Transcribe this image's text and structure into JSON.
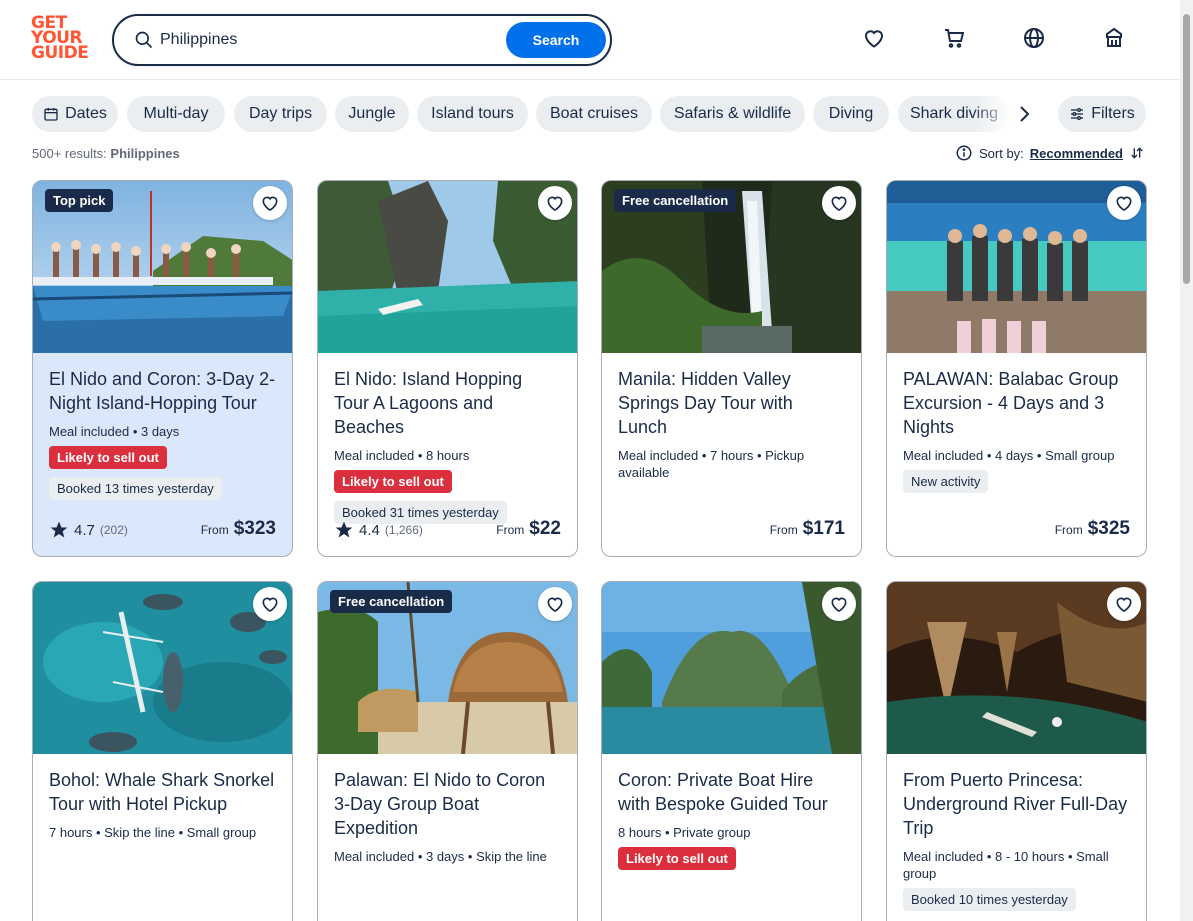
{
  "brand": {
    "logo_lines": [
      "GET",
      "YOUR",
      "GUIDE"
    ],
    "logo_color": "#ff5533"
  },
  "search": {
    "value": "Philippines",
    "button_label": "Search",
    "button_color": "#0071eb"
  },
  "header_icons": [
    "heart-icon",
    "cart-icon",
    "globe-icon",
    "account-icon"
  ],
  "chips": [
    {
      "label": "Dates",
      "icon": "calendar-icon"
    },
    {
      "label": "Multi-day"
    },
    {
      "label": "Day trips"
    },
    {
      "label": "Jungle"
    },
    {
      "label": "Island tours"
    },
    {
      "label": "Boat cruises"
    },
    {
      "label": "Safaris & wildlife"
    },
    {
      "label": "Diving"
    },
    {
      "label": "Shark diving"
    }
  ],
  "filters_label": "Filters",
  "results": {
    "count": "500+ results:",
    "query": "Philippines"
  },
  "sort": {
    "label": "Sort by:",
    "value": "Recommended"
  },
  "cards": [
    {
      "badge": "Top pick",
      "title": "El Nido and Coron: 3-Day 2-Night Island-Hopping Tour",
      "meta": "Meal included • 3 days",
      "red_tag": "Likely to sell out",
      "grey_tag": "Booked 13 times yesterday",
      "rating": "4.7",
      "rating_count": "(202)",
      "from": "From",
      "price": "$323",
      "highlighted": true
    },
    {
      "badge": "",
      "title": "El Nido: Island Hopping Tour A Lagoons and Beaches",
      "meta": "Meal included • 8 hours",
      "red_tag": "Likely to sell out",
      "grey_tag": "Booked 31 times yesterday",
      "rating": "4.4",
      "rating_count": "(1,266)",
      "from": "From",
      "price": "$22"
    },
    {
      "badge": "Free cancellation",
      "title": "Manila: Hidden Valley Springs Day Tour with Lunch",
      "meta": "Meal included • 7 hours • Pickup available",
      "from": "From",
      "price": "$171"
    },
    {
      "badge": "",
      "title": "PALAWAN: Balabac Group Excursion - 4 Days and 3 Nights",
      "meta": "Meal included • 4 days • Small group",
      "grey_tag": "New activity",
      "from": "From",
      "price": "$325"
    },
    {
      "badge": "",
      "title": "Bohol: Whale Shark Snorkel Tour with Hotel Pickup",
      "meta": "7 hours • Skip the line • Small group"
    },
    {
      "badge": "Free cancellation",
      "title": "Palawan: El Nido to Coron 3-Day Group Boat Expedition",
      "meta": "Meal included • 3 days • Skip the line"
    },
    {
      "badge": "",
      "title": "Coron: Private Boat Hire with Bespoke Guided Tour",
      "meta": "8 hours • Private group",
      "red_tag": "Likely to sell out"
    },
    {
      "badge": "",
      "title": "From Puerto Princesa: Underground River Full-Day Trip",
      "meta": "Meal included • 8 - 10 hours • Small group",
      "grey_tag": "Booked 10 times yesterday"
    }
  ]
}
